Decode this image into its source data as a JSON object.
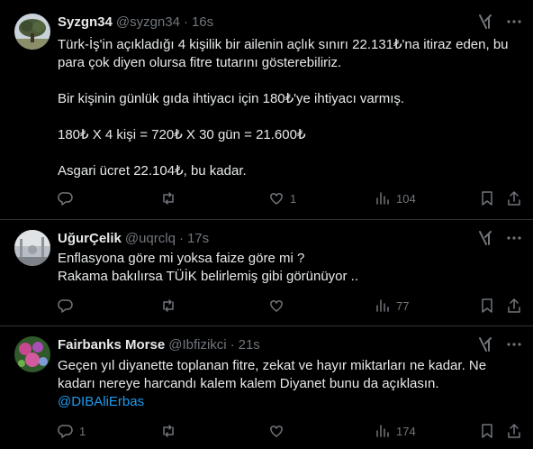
{
  "colors": {
    "background": "#000000",
    "text": "#e7e9ea",
    "muted": "#71767b",
    "link": "#1d9bf0",
    "divider": "#2f3336"
  },
  "tweets": [
    {
      "name": "Syzgn34",
      "handle": "@syzgn34",
      "time": "16s",
      "lines": [
        "Türk-İş'in açıkladığı 4 kişilik bir ailenin açlık sınırı 22.131₺'na itiraz eden, bu para çok diyen olursa fitre tutarını gösterebiliriz.",
        "Bir kişinin günlük gıda ihtiyacı için 180₺'ye ihtiyacı varmış.",
        "180₺ X 4 kişi = 720₺ X 30 gün = 21.600₺",
        "Asgari ücret 22.104₺, bu kadar."
      ],
      "reply_count": "",
      "retweet_count": "",
      "like_count": "1",
      "view_count": "104"
    },
    {
      "name": "UğurÇelik",
      "handle": "@uqrclq",
      "time": "17s",
      "lines": [
        "Enflasyona göre mi yoksa faize göre mi ?",
        "Rakama bakılırsa TÜİK belirlemiş gibi görünüyor .."
      ],
      "reply_count": "",
      "retweet_count": "",
      "like_count": "",
      "view_count": "77"
    },
    {
      "name": "Fairbanks Morse",
      "handle": "@Ibfizikci",
      "time": "21s",
      "lines": [
        "Geçen yıl diyanette toplanan fitre, zekat ve hayır miktarları ne kadar. Ne kadarı nereye harcandı kalem kalem Diyanet bunu da açıklasın."
      ],
      "mention": "@DIBAliErbas",
      "reply_count": "1",
      "retweet_count": "",
      "like_count": "",
      "view_count": "174"
    }
  ],
  "icons": {
    "grok": "grok-icon",
    "more": "more-icon",
    "reply": "reply-icon",
    "retweet": "retweet-icon",
    "like": "like-icon",
    "views": "views-icon",
    "bookmark": "bookmark-icon",
    "share": "share-icon"
  }
}
